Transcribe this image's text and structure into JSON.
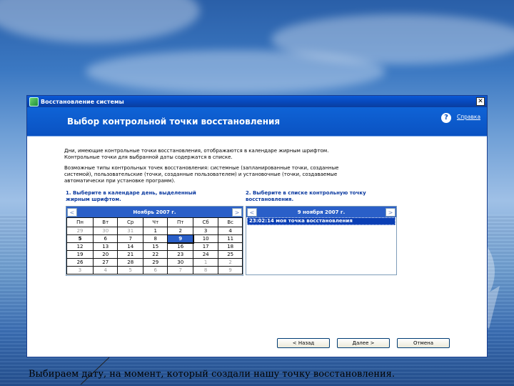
{
  "window": {
    "title": "Восстановление системы",
    "close_label": "✕",
    "header_title": "Выбор контрольной точки восстановления",
    "help_label": "Справка"
  },
  "intro": {
    "line1": "Дни, имеющие контрольные точки восстановления, отображаются в календаре жирным шрифтом.",
    "line2": "Контрольные точки для выбранной даты содержатся в списке.",
    "types1": "Возможные типы контрольных точек восстановления: системные (запланированные точки, созданные",
    "types2": "системой), пользовательские (точки, созданные пользователем) и установочные (точки, создаваемые",
    "types3": "автоматически при установке программ)."
  },
  "step1": {
    "line1": "1. Выберите в календаре день, выделенный",
    "line2": "жирным шрифтом."
  },
  "step2": {
    "line1": "2. Выберите в списке контрольную точку",
    "line2": "восстановления."
  },
  "calendar": {
    "prev": "<",
    "next": ">",
    "month": "Ноябрь 2007 г.",
    "weekdays": [
      "Пн",
      "Вт",
      "Ср",
      "Чт",
      "Пт",
      "Сб",
      "Вс"
    ],
    "weeks": [
      [
        "29",
        "30",
        "31",
        "1",
        "2",
        "3",
        "4"
      ],
      [
        "5",
        "6",
        "7",
        "8",
        "9",
        "10",
        "11"
      ],
      [
        "12",
        "13",
        "14",
        "15",
        "16",
        "17",
        "18"
      ],
      [
        "19",
        "20",
        "21",
        "22",
        "23",
        "24",
        "25"
      ],
      [
        "26",
        "27",
        "28",
        "29",
        "30",
        "1",
        "2"
      ],
      [
        "3",
        "4",
        "5",
        "6",
        "7",
        "8",
        "9"
      ]
    ],
    "selected": "9"
  },
  "restore_list": {
    "prev": "<",
    "next": ">",
    "date": "9 ноября 2007 г.",
    "items": [
      "23:02:14  моя точка восстановления"
    ]
  },
  "buttons": {
    "back": "< Назад",
    "next": "Далее >",
    "cancel": "Отмена"
  },
  "caption": "Выбираем дату, на момент, который создали нашу точку восстановления.",
  "colors": {
    "accent": "#0a52c2",
    "selection": "#2a5fc8"
  }
}
